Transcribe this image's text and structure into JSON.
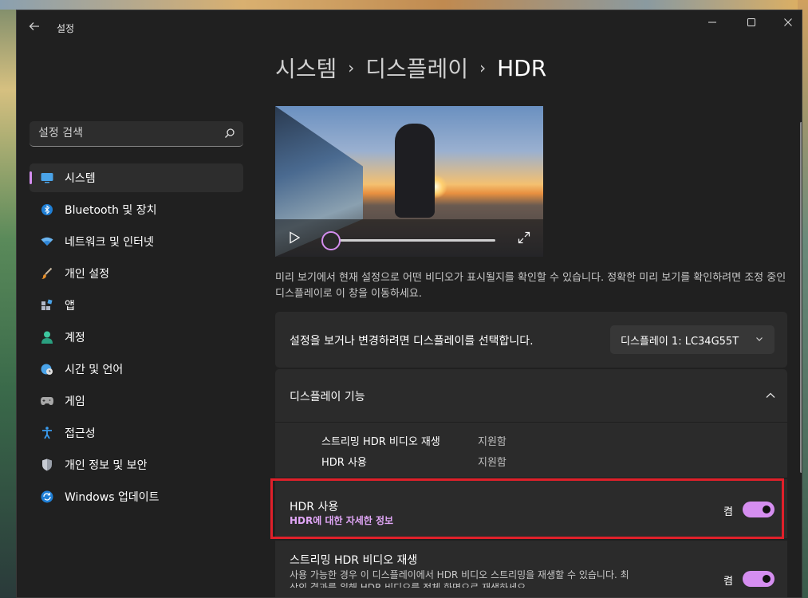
{
  "window": {
    "title": "설정",
    "controls": {
      "minimize": "minimize",
      "maximize": "maximize",
      "close": "close"
    }
  },
  "search": {
    "placeholder": "설정 검색"
  },
  "sidebar": {
    "items": [
      {
        "label": "시스템",
        "icon": "monitor-icon",
        "active": true
      },
      {
        "label": "Bluetooth 및 장치",
        "icon": "bluetooth-icon"
      },
      {
        "label": "네트워크 및 인터넷",
        "icon": "wifi-icon"
      },
      {
        "label": "개인 설정",
        "icon": "brush-icon"
      },
      {
        "label": "앱",
        "icon": "apps-icon"
      },
      {
        "label": "계정",
        "icon": "account-icon"
      },
      {
        "label": "시간 및 언어",
        "icon": "globe-clock-icon"
      },
      {
        "label": "게임",
        "icon": "gamepad-icon"
      },
      {
        "label": "접근성",
        "icon": "accessibility-icon"
      },
      {
        "label": "개인 정보 및 보안",
        "icon": "shield-icon"
      },
      {
        "label": "Windows 업데이트",
        "icon": "update-icon"
      }
    ]
  },
  "breadcrumb": {
    "level1": "시스템",
    "level2": "디스플레이",
    "level3": "HDR"
  },
  "preview": {
    "description": "미리 보기에서 현재 설정으로 어떤 비디오가 표시될지를 확인할 수 있습니다. 정확한 미리 보기를 확인하려면 조정 중인 디스플레이로 이 창을 이동하세요.",
    "progress": 0
  },
  "display_select": {
    "label": "설정을 보거나 변경하려면 디스플레이를 선택합니다.",
    "selected": "디스플레이 1: LC34G55T"
  },
  "display_features": {
    "title": "디스플레이 기능",
    "rows": [
      {
        "name": "스트리밍 HDR 비디오 재생",
        "value": "지원함"
      },
      {
        "name": "HDR 사용",
        "value": "지원함"
      }
    ]
  },
  "hdr_setting": {
    "title": "HDR 사용",
    "link": "HDR에 대한 자세한 정보",
    "state": "켬",
    "enabled": true
  },
  "streaming_setting": {
    "title": "스트리밍 HDR 비디오 재생",
    "description": "사용 가능한 경우 이 디스플레이에서 HDR 비디오 스트리밍을 재생할 수 있습니다. 최상의 결과를 위해 HDR 비디오를 전체 화면으로 재생하세요.",
    "state": "켬",
    "enabled": true
  },
  "colors": {
    "accent": "#d58ef0",
    "highlight_border": "#e0202a",
    "window_bg": "#202020",
    "card_bg": "#2b2b2b"
  }
}
